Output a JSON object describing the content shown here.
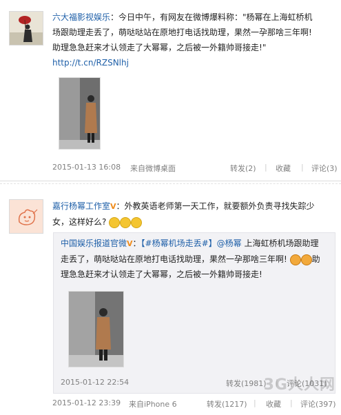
{
  "post1": {
    "author": "六大福影视娱乐",
    "colon": "：",
    "text_line1": "今日中午，有网友在微博爆料称：\"杨幂在上海虹桥机",
    "text_line2": "场跟助理走丢了，萌哒哒站在原地打电话找助理，果然一孕那啥三年啊!",
    "text_line3": "助理急急赶来才认领走了大幂幂，之后被一外籍帅哥接走!\"",
    "link": "http://t.cn/RZSNlhj",
    "timestamp": "2015-01-13 16:08",
    "source": "来自微博桌面",
    "repost": "转发(2)",
    "favorite": "收藏",
    "comment": "评论(3)"
  },
  "post2": {
    "author": "嘉行杨幂工作室",
    "verified": "V",
    "text_line1": "外教英语老师第一天工作，就要额外负责寻找失踪少",
    "text_line2": "女，这样好么?",
    "quote": {
      "author": "中国娱乐报道官微",
      "verified": "V",
      "colon": "：",
      "topic": "【#杨幂机场走丢#】",
      "mention": "@杨幂",
      "text_line1_rest": "上海虹桥机场跟助理",
      "text_line2": "走丢了，萌哒哒站在原地打电话找助理，果然一孕那啥三年啊!",
      "text_line2_tail": "助",
      "text_line3": "理急急赶来才认领走了大幂幂，之后被一外籍帅哥接走!",
      "timestamp": "2015-01-12 22:54",
      "repost": "转发(1981)",
      "comment": "评论(1031)"
    },
    "timestamp": "2015-01-12 23:39",
    "source": "来自iPhone 6",
    "repost": "转发(1217)",
    "favorite": "收藏",
    "comment": "评论(397)"
  },
  "watermark": "3G人人网",
  "colors": {
    "link": "#1e5fa8",
    "meta": "#808080",
    "quote_bg": "#f2f2f5"
  }
}
